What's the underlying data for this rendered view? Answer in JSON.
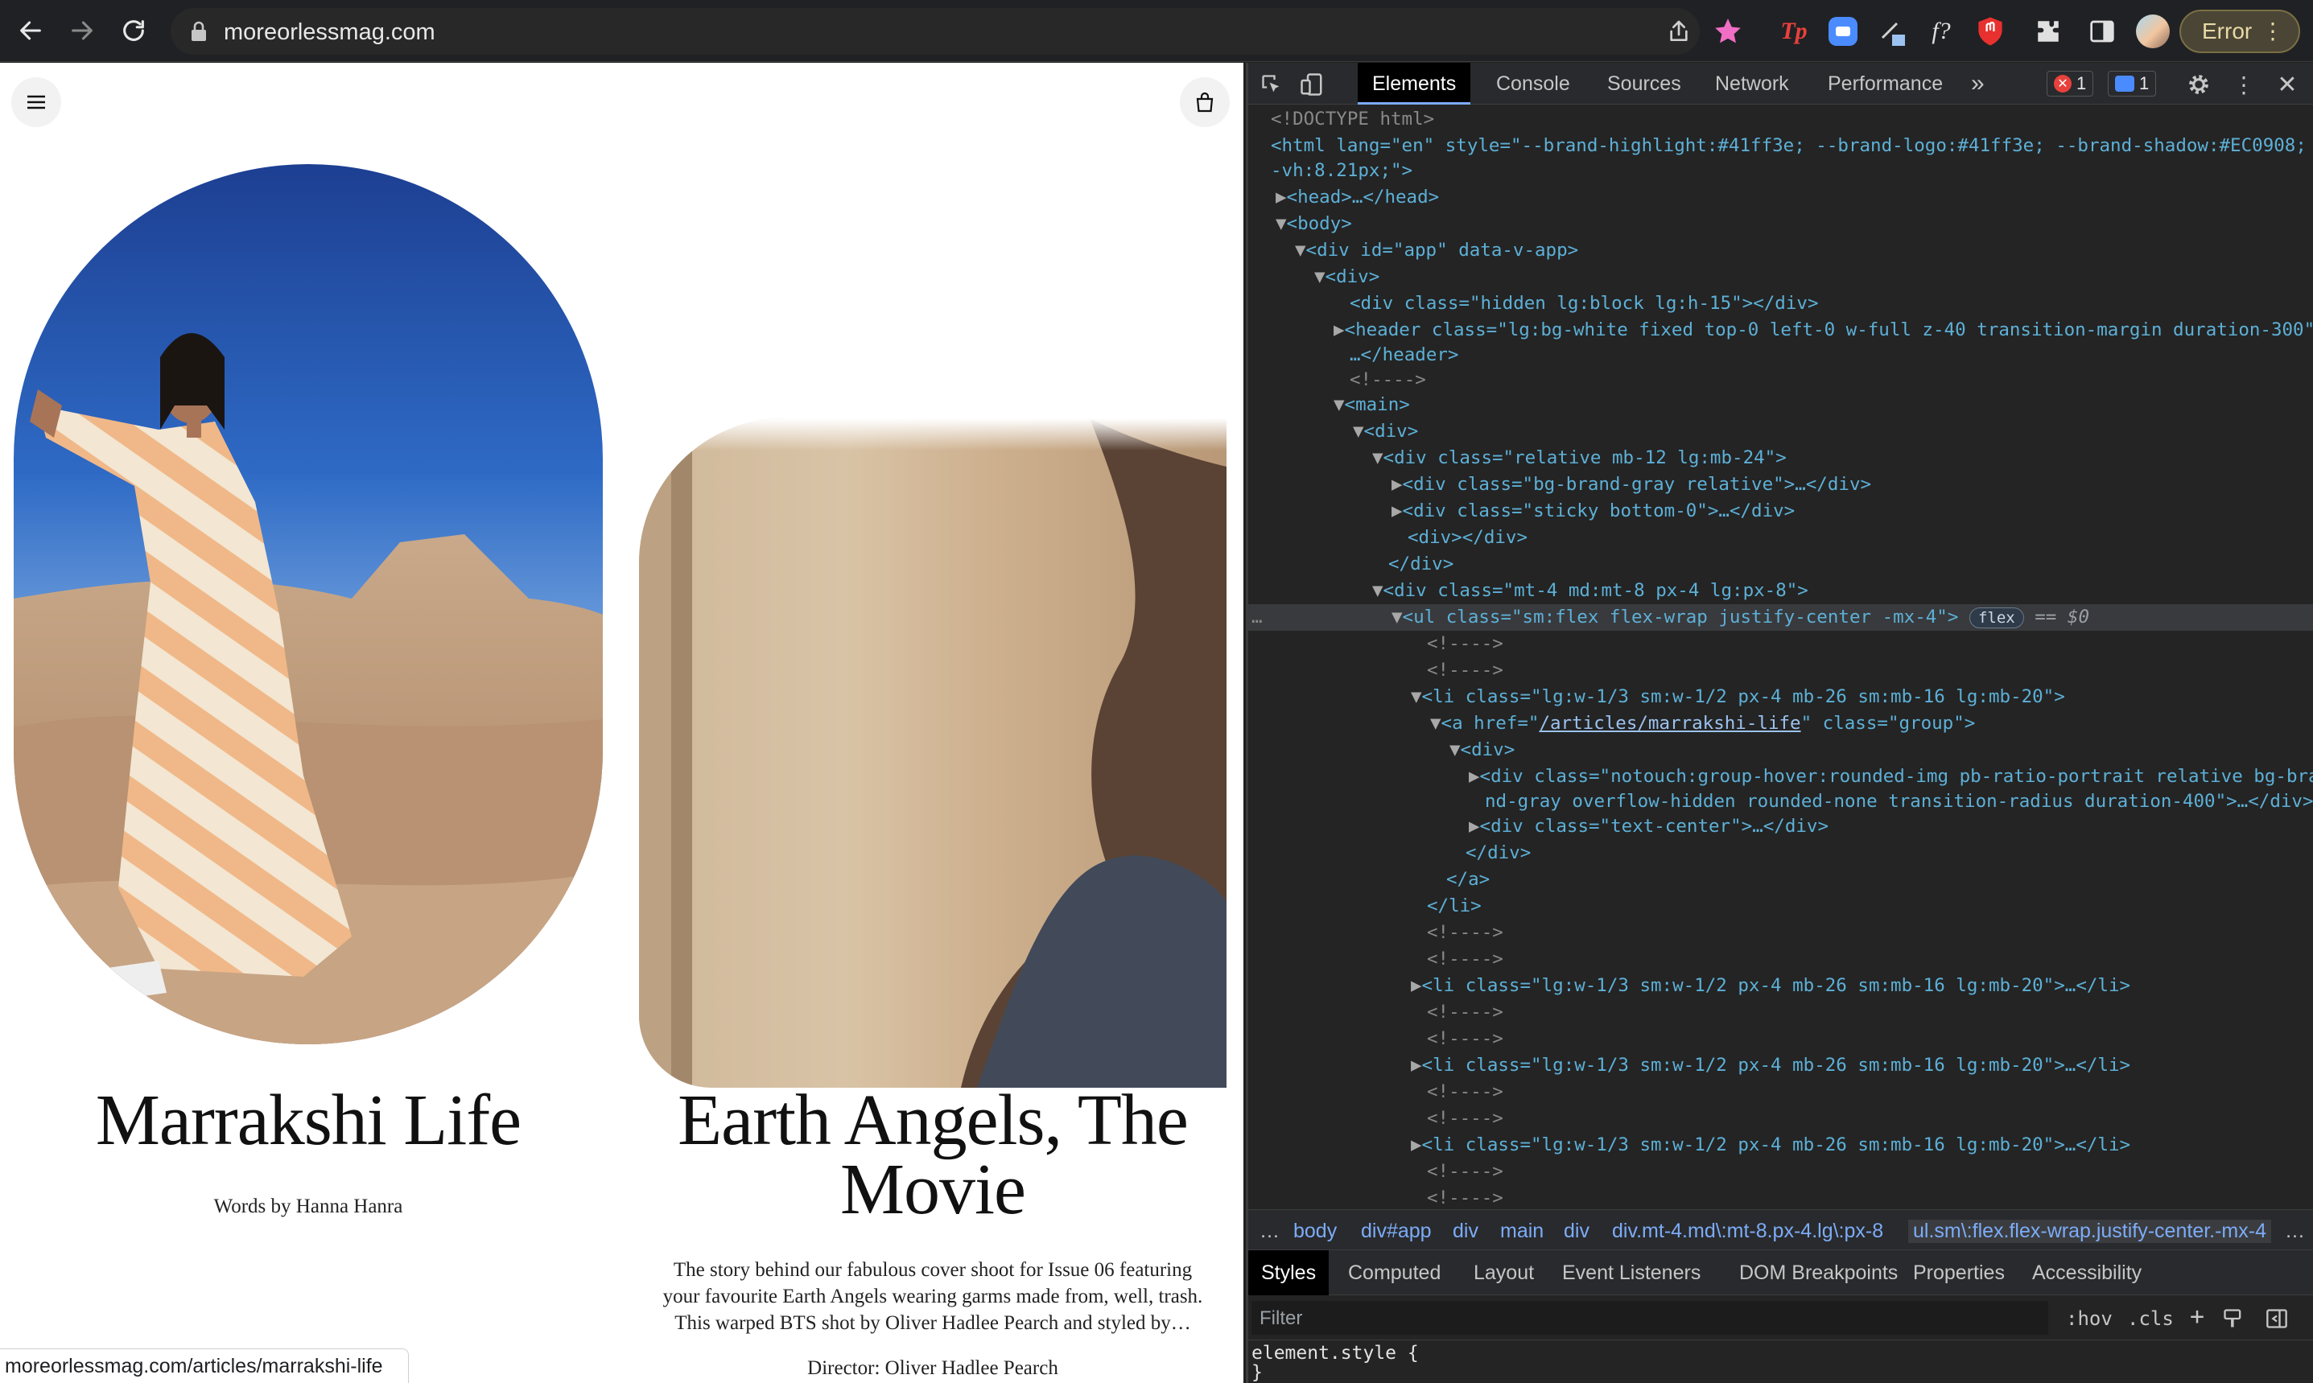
{
  "browser": {
    "url": "moreorlessmag.com",
    "error_label": "Error",
    "status_url": "moreorlessmag.com/articles/marrakshi-life",
    "extensions": [
      "tp-extension-icon",
      "zoom-extension-icon",
      "pen-extension-icon",
      "formula-extension-icon",
      "shield-extension-icon",
      "puzzle-icon",
      "side-panel-icon",
      "profile-avatar"
    ]
  },
  "page": {
    "cards": [
      {
        "title": "Marrakshi Life",
        "subtitle": "Words by Hanna Hanra"
      },
      {
        "title_line1": "Earth Angels, The",
        "title_line2": "Movie",
        "desc_line1": "The story behind our fabulous cover shoot for Issue 06 featuring",
        "desc_line2": "your favourite Earth Angels wearing garms made from, well, trash.",
        "desc_line3": "This warped BTS shot by Oliver Hadlee Pearch and styled by…",
        "credit": "Director: Oliver Hadlee Pearch"
      }
    ]
  },
  "devtools": {
    "tabs": [
      "Elements",
      "Console",
      "Sources",
      "Network",
      "Performance"
    ],
    "more_tabs": "»",
    "errors_count": "1",
    "messages_count": "1",
    "dom": {
      "doctype": "<!DOCTYPE html>",
      "html_open_1": "<html lang=\"en\" style=\"--brand-highlight:#41ff3e; --brand-logo:#41ff3e; --brand-shadow:#EC0908; -",
      "html_open_2": "-vh:8.21px;\">",
      "head": "<head>…</head>",
      "body": "<body>",
      "app": "<div id=\"app\" data-v-app>",
      "div1": "<div>",
      "hidden_div": "<div class=\"hidden lg:block lg:h-15\"></div>",
      "header_1": "<header class=\"lg:bg-white fixed top-0 left-0 w-full z-40 transition-margin duration-300\">",
      "header_2": "…</header>",
      "comment": "<!---->",
      "main": "<main>",
      "div2": "<div>",
      "relative_div": "<div class=\"relative mb-12 lg:mb-24\">",
      "gray_div": "<div class=\"bg-brand-gray relative\">…</div>",
      "sticky_div": "<div class=\"sticky bottom-0\">…</div>",
      "empty_div": "<div></div>",
      "close_div": "</div>",
      "mt_div": "<div class=\"mt-4 md:mt-8 px-4 lg:px-8\">",
      "ul_open": "<ul class=\"sm:flex flex-wrap justify-center -mx-4\">",
      "flex_badge": "flex",
      "selected_marker": "== $0",
      "li_open": "<li class=\"lg:w-1/3 sm:w-1/2 px-4 mb-26 sm:mb-16 lg:mb-20\">",
      "a_open_pre": "<a href=\"",
      "a_href": "/articles/marrakshi-life",
      "a_open_post": "\" class=\"group\">",
      "div3": "<div>",
      "notouch_1": "<div class=\"notouch:group-hover:rounded-img pb-ratio-portrait relative bg-bra",
      "notouch_2": "nd-gray overflow-hidden rounded-none transition-radius duration-400\">…</div>",
      "text_center": "<div class=\"text-center\">…</div>",
      "close_a": "</a>",
      "close_li": "</li>",
      "li_collapsed": "<li class=\"lg:w-1/3 sm:w-1/2 px-4 mb-26 sm:mb-16 lg:mb-20\">…</li>"
    },
    "breadcrumbs": [
      "…",
      "body",
      "div#app",
      "div",
      "main",
      "div",
      "div.mt-4.md\\:mt-8.px-4.lg\\:px-8",
      "ul.sm\\:flex.flex-wrap.justify-center.-mx-4",
      "…"
    ],
    "subtabs": [
      "Styles",
      "Computed",
      "Layout",
      "Event Listeners",
      "DOM Breakpoints",
      "Properties",
      "Accessibility"
    ],
    "filter_placeholder": "Filter",
    "hov": ":hov",
    "cls": ".cls",
    "element_style_open": "element.style {",
    "element_style_close": "}"
  },
  "colors": {
    "accent_blue": "#7cacf8",
    "error_red": "#f28b82",
    "brand_highlight": "#41ff3e",
    "brand_shadow": "#EC0908"
  }
}
